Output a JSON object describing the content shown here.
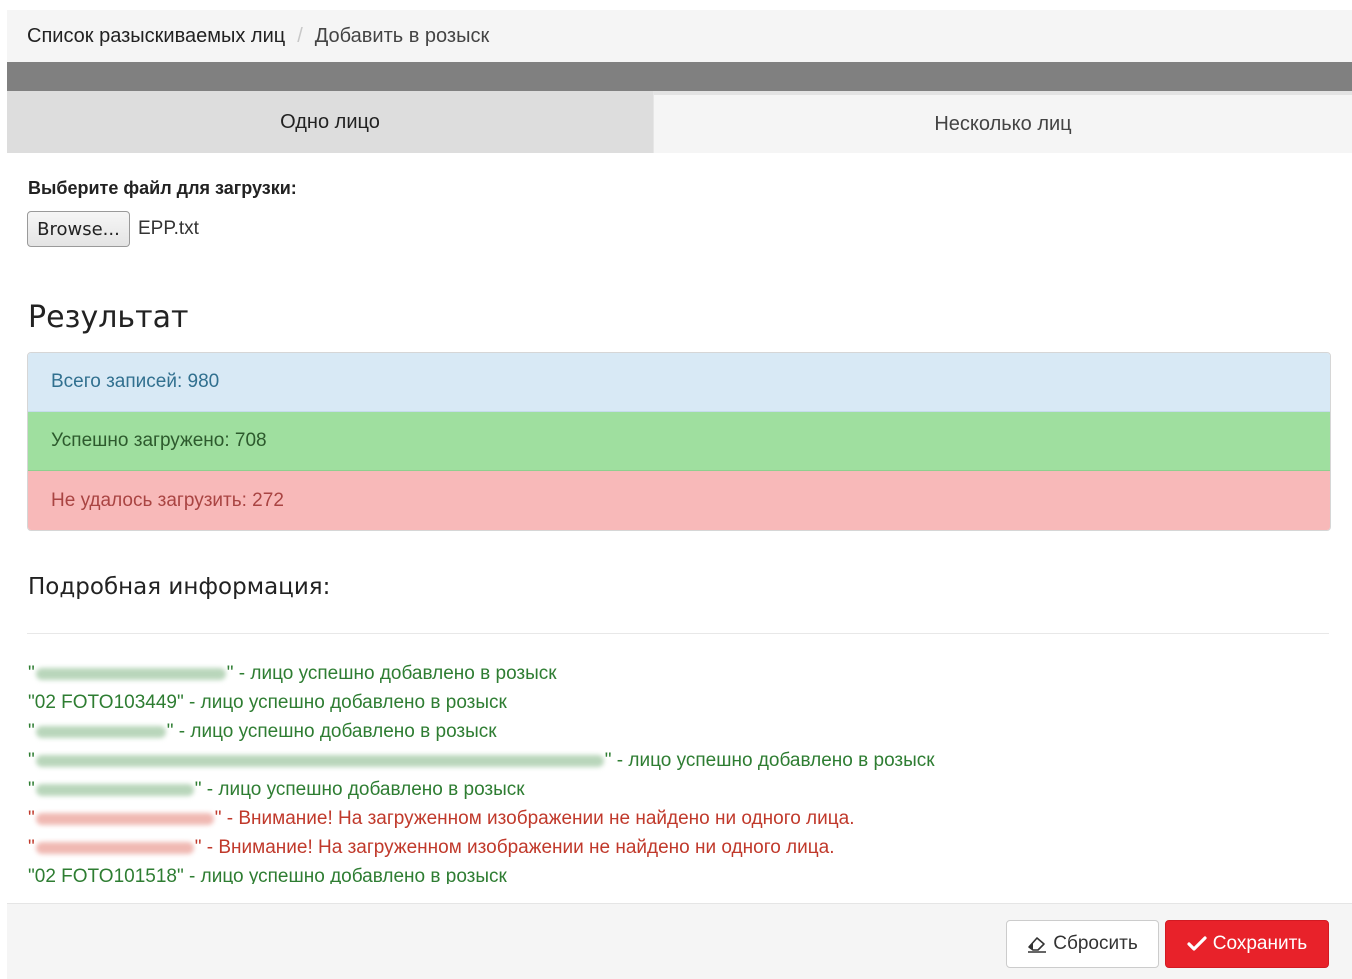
{
  "breadcrumb": {
    "parent": "Список разыскиваемых лиц",
    "separator": "/",
    "current": "Добавить в розыск"
  },
  "tabs": [
    {
      "label": "Одно лицо",
      "active": true
    },
    {
      "label": "Несколько лиц",
      "active": false
    }
  ],
  "upload": {
    "label": "Выберите файл для загрузки:",
    "browse_label": "Browse...",
    "file_name": "EPP.txt"
  },
  "result": {
    "title": "Результат",
    "total": "Всего записей: 980",
    "success": "Успешно загружено: 708",
    "failed": "Не удалось загрузить: 272"
  },
  "details": {
    "title": "Подробная информация:",
    "lines": [
      {
        "status": "ok",
        "quote": "\"",
        "name": "",
        "close": "\"",
        "message": " - лицо успешно добавлено в розыск"
      },
      {
        "status": "ok",
        "quote": "\"",
        "name": "02 FOTO103449",
        "close": "\"",
        "message": " - лицо успешно добавлено в розыск"
      },
      {
        "status": "ok",
        "quote": "\"",
        "name": "",
        "close": "\"",
        "message": " - лицо успешно добавлено в розыск"
      },
      {
        "status": "ok",
        "quote": "\"",
        "name": "",
        "close": "\"",
        "message": " - лицо успешно добавлено в розыск"
      },
      {
        "status": "ok",
        "quote": "\"",
        "name": "",
        "close": "\"",
        "message": " - лицо успешно добавлено в розыск"
      },
      {
        "status": "warn",
        "quote": "\"",
        "name": "",
        "close": "\"",
        "message": " - Внимание! На загруженном изображении не найдено ни одного лица."
      },
      {
        "status": "warn",
        "quote": "\"",
        "name": "",
        "close": "\"",
        "message": " - Внимание! На загруженном изображении не найдено ни одного лица."
      },
      {
        "status": "ok",
        "quote": "\"",
        "name": "02 FOTO101518",
        "close": "\"",
        "message": " - лицо успешно добавлено в розыск"
      }
    ]
  },
  "footer": {
    "reset_label": "Сбросить",
    "save_label": "Сохранить"
  },
  "colors": {
    "success_text": "#2e7d32",
    "warning_text": "#c0392b",
    "save_button": "#e8222a",
    "tab_active": "#dddddd"
  },
  "icons": {
    "reset": "eraser-icon",
    "save": "check-icon"
  }
}
